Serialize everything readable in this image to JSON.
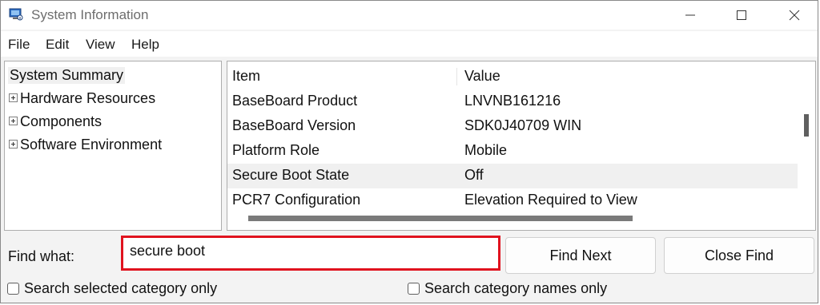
{
  "window": {
    "title": "System Information",
    "icon": "system-info-icon"
  },
  "menu": [
    "File",
    "Edit",
    "View",
    "Help"
  ],
  "tree": {
    "root": "System Summary",
    "children": [
      "Hardware Resources",
      "Components",
      "Software Environment"
    ]
  },
  "details": {
    "columns": [
      "Item",
      "Value"
    ],
    "rows": [
      {
        "item": "BaseBoard Product",
        "value": "LNVNB161216"
      },
      {
        "item": "BaseBoard Version",
        "value": "SDK0J40709 WIN"
      },
      {
        "item": "Platform Role",
        "value": "Mobile"
      },
      {
        "item": "Secure Boot State",
        "value": "Off"
      },
      {
        "item": "PCR7 Configuration",
        "value": "Elevation Required to View"
      }
    ],
    "highlight_color": "#f0f0f0"
  },
  "find": {
    "label": "Find what:",
    "value": "secure boot",
    "border_color": "#e0131f",
    "find_next": "Find Next",
    "close_find": "Close Find",
    "opt_selected_category": "Search selected category only",
    "opt_category_names": "Search category names only"
  }
}
